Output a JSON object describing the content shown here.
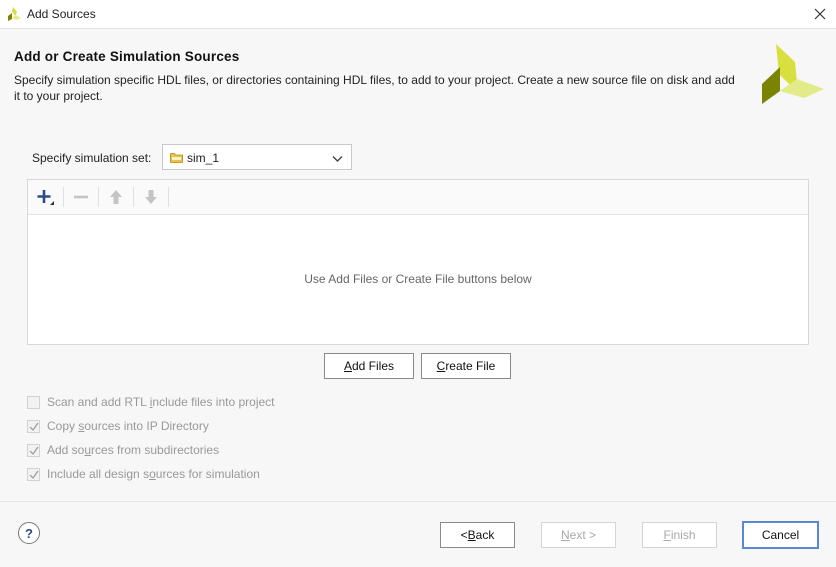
{
  "window": {
    "title": "Add Sources",
    "close_icon": "close-icon"
  },
  "header": {
    "title": "Add or Create Simulation Sources",
    "description": "Specify simulation specific HDL files, or directories containing HDL files, to add to your project. Create a new source file on disk and add it to your project."
  },
  "simulation_set": {
    "label": "Specify simulation set:",
    "value": "sim_1"
  },
  "file_list": {
    "toolbar": [
      {
        "name": "add",
        "icon": "plus-icon",
        "enabled": true
      },
      {
        "name": "remove",
        "icon": "minus-icon",
        "enabled": false
      },
      {
        "name": "move-up",
        "icon": "arrow-up-icon",
        "enabled": false
      },
      {
        "name": "move-down",
        "icon": "arrow-down-icon",
        "enabled": false
      }
    ],
    "empty_message": "Use Add Files or Create File buttons below"
  },
  "buttons": {
    "add_files": {
      "mn": "A",
      "rest": "dd Files"
    },
    "create_file": {
      "mn": "C",
      "rest": "reate File"
    }
  },
  "options": [
    {
      "pre": "Scan and add RTL ",
      "mn": "i",
      "post": "nclude files into project",
      "checked": false,
      "enabled": false
    },
    {
      "pre": "Copy ",
      "mn": "s",
      "post": "ources into IP Directory",
      "checked": true,
      "enabled": false
    },
    {
      "pre": "Add so",
      "mn": "u",
      "post": "rces from subdirectories",
      "checked": true,
      "enabled": false
    },
    {
      "pre": "Include all design s",
      "mn": "o",
      "post": "urces for simulation",
      "checked": true,
      "enabled": false
    }
  ],
  "footer": {
    "help": "?",
    "back": {
      "pre": "< ",
      "mn": "B",
      "post": "ack"
    },
    "next": {
      "pre": "",
      "mn": "N",
      "post": "ext >"
    },
    "finish": {
      "pre": "",
      "mn": "F",
      "post": "inish"
    },
    "cancel": "Cancel"
  },
  "colors": {
    "accent": "#5b86d1",
    "logo_light": "#dce35a",
    "logo_dark": "#7a8400"
  }
}
